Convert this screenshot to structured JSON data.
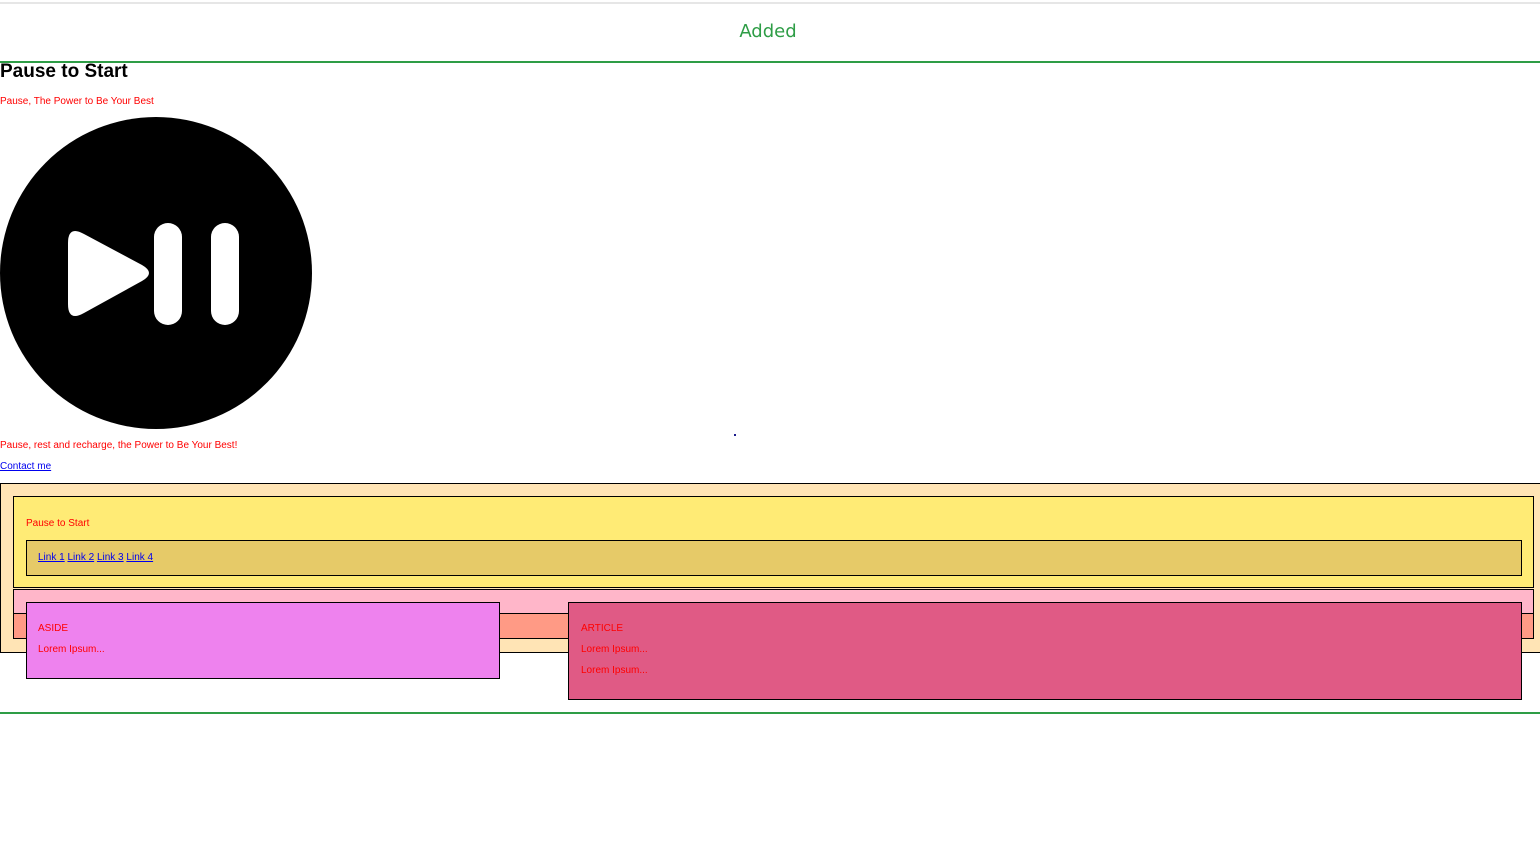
{
  "banner": {
    "label": "Added"
  },
  "page": {
    "title": "Pause to Start",
    "subtitle": "Pause, The Power to Be Your Best",
    "tagline": "Pause, rest and recharge, the Power to Be Your Best!",
    "contact_link": "Contact me"
  },
  "icons": {
    "hero": "play-pause-icon"
  },
  "header": {
    "title": "Pause to Start",
    "nav_links": [
      "Link 1",
      "Link 2",
      "Link 3",
      "Link 4"
    ]
  },
  "aside": {
    "heading": "ASIDE",
    "body": "Lorem Ipsum..."
  },
  "article": {
    "heading": "ARTICLE",
    "paragraphs": [
      "Lorem Ipsum...",
      "Lorem Ipsum..."
    ]
  },
  "colors": {
    "accent_green": "#2e9d46",
    "text_red": "#ff0000",
    "link_blue": "#0000ee",
    "outer_bg": "#ffe4b5",
    "header_bg": "#ffeb75",
    "nav_bg": "#e6ca68",
    "pink_band": "#ffb6c9",
    "salmon_band": "#ff9a85",
    "aside_bg": "#ee82ee",
    "article_bg": "#e05a85"
  }
}
